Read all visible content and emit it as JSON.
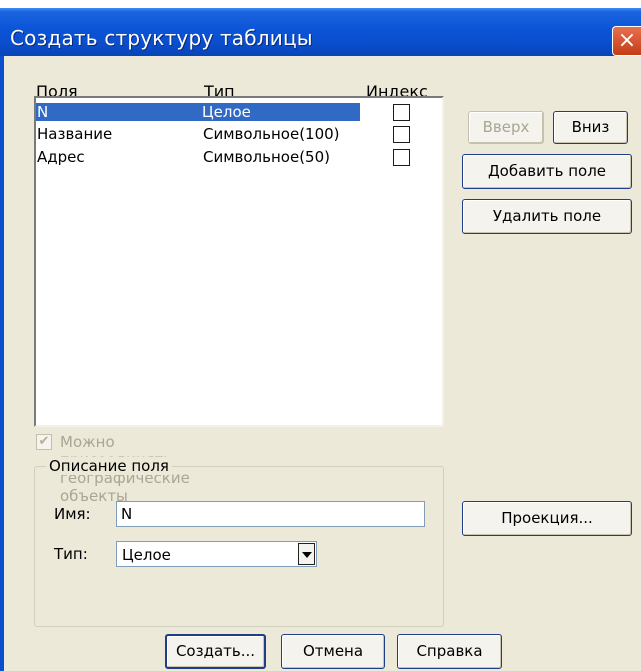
{
  "window": {
    "title": "Создать структуру таблицы",
    "close_icon": "×"
  },
  "fields_list": {
    "headers": {
      "name": "Поля",
      "type": "Тип",
      "index": "Индекс"
    },
    "rows": [
      {
        "name": "N",
        "type": "Целое",
        "index": false,
        "selected": true
      },
      {
        "name": "Название",
        "type": "Символьное(100)",
        "index": false,
        "selected": false
      },
      {
        "name": "Адрес",
        "type": "Символьное(50)",
        "index": false,
        "selected": false
      }
    ]
  },
  "side_buttons": {
    "up": "Вверх",
    "down": "Вниз",
    "add_field": "Добавить поле",
    "delete_field": "Удалить поле",
    "projection": "Проекция..."
  },
  "geo_checkbox": {
    "label": "Можно присоединять географические объекты",
    "checked": true,
    "enabled": false
  },
  "field_description": {
    "legend": "Описание поля",
    "name_label": "Имя:",
    "name_value": "N",
    "type_label": "Тип:",
    "type_value": "Целое"
  },
  "bottom_buttons": {
    "create": "Создать...",
    "cancel": "Отмена",
    "help": "Справка"
  },
  "colors": {
    "selection": "#316AC5",
    "dialog_bg": "#ECE9D8",
    "titlebar": "#0A4FCF"
  }
}
